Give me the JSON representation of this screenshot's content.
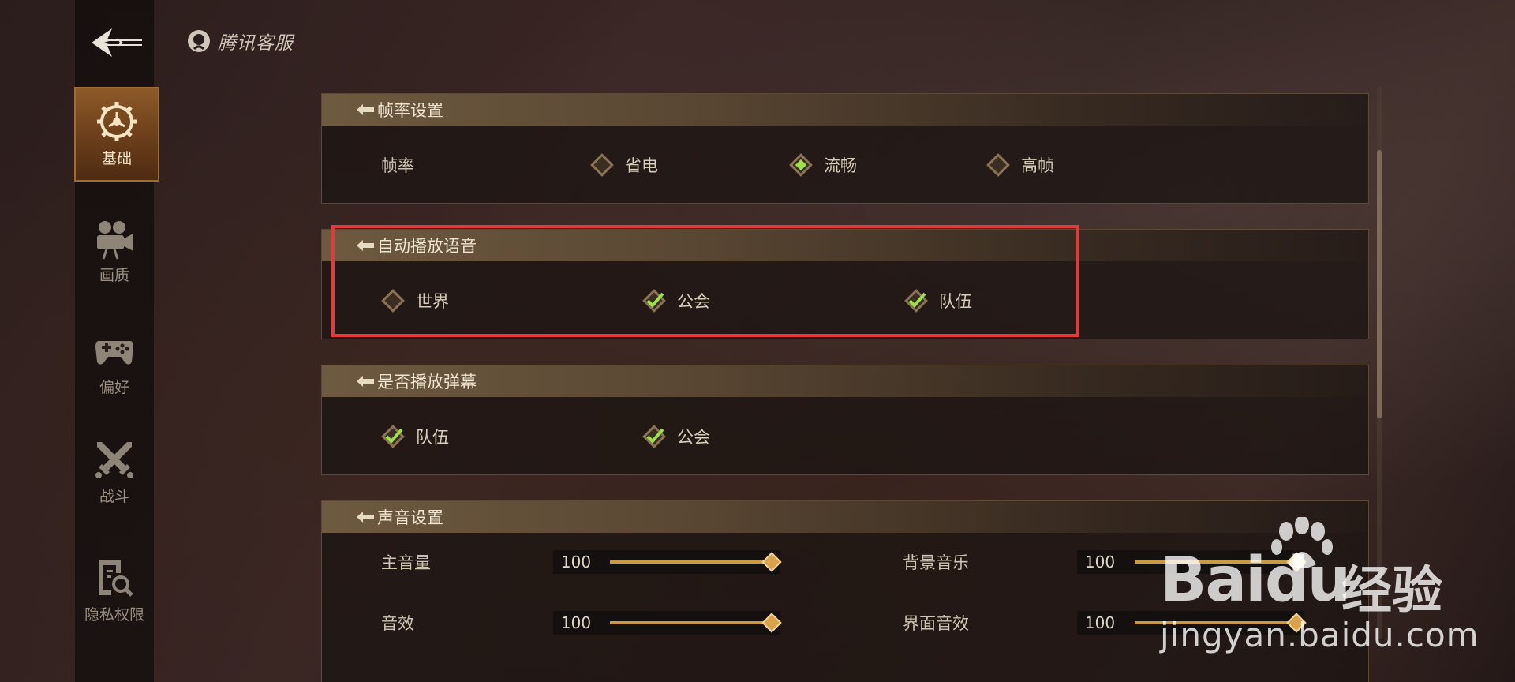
{
  "header": {
    "logo_text": "腾讯客服"
  },
  "sidebar": {
    "items": [
      {
        "label": "基础",
        "icon": "gear-icon",
        "active": true
      },
      {
        "label": "画质",
        "icon": "video-camera-icon",
        "active": false
      },
      {
        "label": "偏好",
        "icon": "gamepad-icon",
        "active": false
      },
      {
        "label": "战斗",
        "icon": "crossed-swords-icon",
        "active": false
      },
      {
        "label": "隐私权限",
        "icon": "privacy-search-icon",
        "active": false
      }
    ]
  },
  "sections": {
    "framerate": {
      "title": "帧率设置",
      "row_label": "帧率",
      "options": [
        {
          "label": "省电",
          "selected": false
        },
        {
          "label": "流畅",
          "selected": true
        },
        {
          "label": "高帧",
          "selected": false
        }
      ]
    },
    "auto_voice": {
      "title": "自动播放语音",
      "options": [
        {
          "label": "世界",
          "checked": false
        },
        {
          "label": "公会",
          "checked": true
        },
        {
          "label": "队伍",
          "checked": true
        }
      ]
    },
    "danmaku": {
      "title": "是否播放弹幕",
      "options": [
        {
          "label": "队伍",
          "checked": true
        },
        {
          "label": "公会",
          "checked": true
        }
      ]
    },
    "sound": {
      "title": "声音设置",
      "sliders": [
        {
          "label": "主音量",
          "value": "100",
          "level": 1.0
        },
        {
          "label": "背景音乐",
          "value": "100",
          "level": 1.0
        },
        {
          "label": "音效",
          "value": "100",
          "level": 1.0
        },
        {
          "label": "界面音效",
          "value": "100",
          "level": 1.0
        }
      ]
    }
  },
  "watermark": {
    "brand": "Bai",
    "brand2": "du",
    "cn": "经验",
    "url": "jingyan.baidu.com"
  },
  "colors": {
    "accent_gold": "#c99a45",
    "selected_green": "#9ee04a",
    "highlight_red": "#e23a3a",
    "active_tab": "#8d5a28"
  }
}
